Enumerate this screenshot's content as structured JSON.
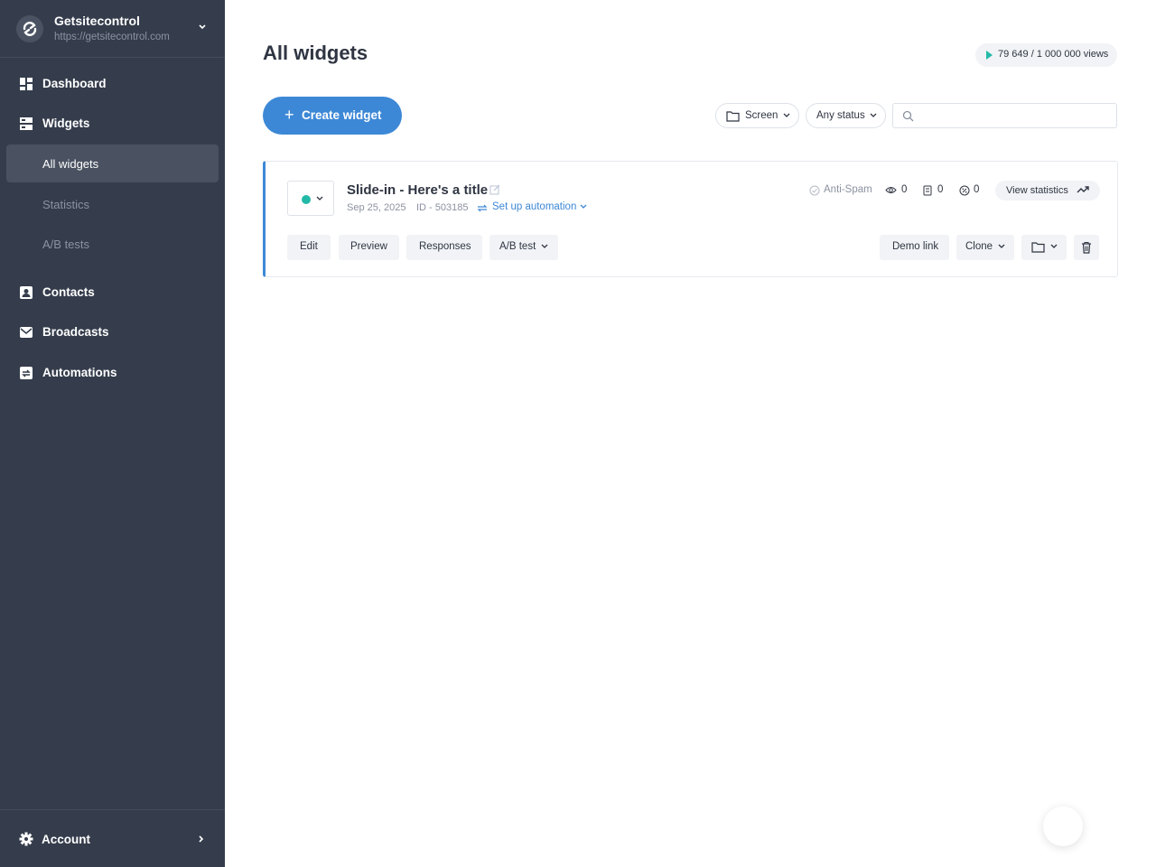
{
  "site": {
    "name": "Getsitecontrol",
    "url": "https://getsitecontrol.com"
  },
  "nav": {
    "dashboard": "Dashboard",
    "widgets": "Widgets",
    "all_widgets": "All widgets",
    "statistics": "Statistics",
    "ab_tests": "A/B tests",
    "contacts": "Contacts",
    "broadcasts": "Broadcasts",
    "automations": "Automations",
    "account": "Account"
  },
  "header": {
    "title": "All widgets",
    "views": "79 649 / 1 000 000 views"
  },
  "toolbar": {
    "create_label": "Create widget",
    "plus": "+",
    "screen_filter": "Screen",
    "status_filter": "Any status",
    "search_placeholder": ""
  },
  "widget": {
    "title": "Slide-in - Here's a title",
    "date": "Sep 25, 2025",
    "id": "ID - 503185",
    "automation": "Set up automation",
    "status_color": "#23b9a8",
    "anti_spam": "Anti-Spam",
    "views_count": "0",
    "responses_count": "0",
    "conversion_count": "0",
    "view_statistics": "View statistics",
    "actions": {
      "edit": "Edit",
      "preview": "Preview",
      "responses": "Responses",
      "ab_test": "A/B test",
      "demo_link": "Demo link",
      "clone": "Clone"
    }
  },
  "colors": {
    "accent": "#3d88d6",
    "sidebar": "#353d4c",
    "active_status": "#23b9a8"
  }
}
